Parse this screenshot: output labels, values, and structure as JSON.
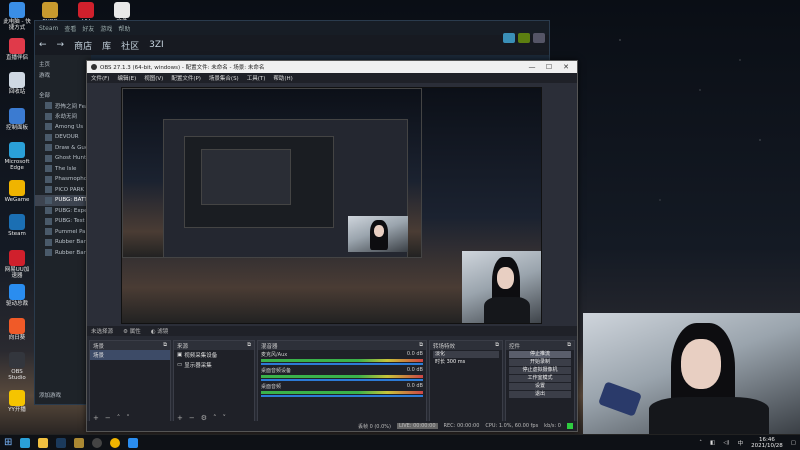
{
  "desktop": {
    "icons": [
      {
        "label": "此电脑 - 快捷方式",
        "color": "#3a8ee6"
      },
      {
        "label": "直播伴侣",
        "color": "#e03a4a"
      },
      {
        "label": "回收站",
        "color": "#cfd8e3"
      },
      {
        "label": "控制面板",
        "color": "#3b7bd1"
      },
      {
        "label": "Microsoft Edge",
        "color": "#2aa0d8"
      },
      {
        "label": "WeGame",
        "color": "#f0b400"
      },
      {
        "label": "Steam",
        "color": "#1b6fb3"
      },
      {
        "label": "网易UU加速器",
        "color": "#d0202c"
      },
      {
        "label": "驱动总裁",
        "color": "#2a8df0"
      },
      {
        "label": "向日葵",
        "color": "#f05a28"
      },
      {
        "label": "OBS Studio",
        "color": "#33363d"
      },
      {
        "label": "YY开播",
        "color": "#f5c400"
      }
    ],
    "top_icons": [
      {
        "label": "PUBG",
        "color": "#c99a2e"
      },
      {
        "label": "UU",
        "color": "#d0202c"
      },
      {
        "label": "文件",
        "color": "#e8e8e8"
      }
    ]
  },
  "steam": {
    "top": [
      "Steam",
      "查看",
      "好友",
      "游戏",
      "帮助"
    ],
    "nav": [
      "商店",
      "库",
      "社区",
      "3ZI"
    ],
    "side_header": "主页",
    "filter_label": "游戏",
    "side_section": "全部",
    "games": [
      "恐怖之间 Fea",
      "永劫无间",
      "Among Us",
      "DEVOUR",
      "Draw & Gues",
      "Ghost Hunte",
      "The Isle",
      "Phasmophob",
      "PICO PARK",
      "PUBG: BATTL",
      "PUBG: Exper",
      "PUBG: Test S",
      "Pummel Part",
      "Rubber Band",
      "Rubber Band"
    ],
    "active_game_index": 9,
    "add_game": "添加游戏"
  },
  "obs": {
    "title": "OBS 27.1.3 (64-bit, windows) - 配置文件: 未命名 - 场景: 未命名",
    "menu": [
      "文件(F)",
      "编辑(E)",
      "视图(V)",
      "配置文件(P)",
      "场景集合(S)",
      "工具(T)",
      "帮助(H)"
    ],
    "context": [
      "未选择源",
      "属性",
      "滤镜"
    ],
    "docks": {
      "scenes": {
        "title": "场景",
        "items": [
          "场景"
        ]
      },
      "sources": {
        "title": "来源",
        "items": [
          "视频采集设备",
          "显示器采集"
        ]
      },
      "mixer": {
        "title": "混音器",
        "rows": [
          {
            "name": "麦克风/Aux",
            "db": "0.0 dB"
          },
          {
            "name": "桌面音频设备",
            "db": "0.0 dB"
          },
          {
            "name": "桌面音频",
            "db": "0.0 dB"
          }
        ]
      },
      "transitions": {
        "title": "转场特效",
        "type": "淡化",
        "duration_label": "时长",
        "duration": "300 ms"
      },
      "controls": {
        "title": "控件",
        "buttons": [
          "停止推流",
          "开始录制",
          "停止虚拟摄像机",
          "工作室模式",
          "设置",
          "退出"
        ]
      }
    },
    "status": {
      "dropped": "丢帧 0 (0.0%)",
      "live": "LIVE: 00:00:00",
      "rec": "REC: 00:00:00",
      "cpu": "CPU: 1.0%, 60.00 fps",
      "kbps": "kb/s: 0"
    }
  },
  "taskbar": {
    "time": "16:46",
    "date": "2021/10/28",
    "lang": "中",
    "apps": [
      "start",
      "edge",
      "explorer",
      "steam",
      "unknown",
      "obs",
      "wegame",
      "ie"
    ]
  }
}
